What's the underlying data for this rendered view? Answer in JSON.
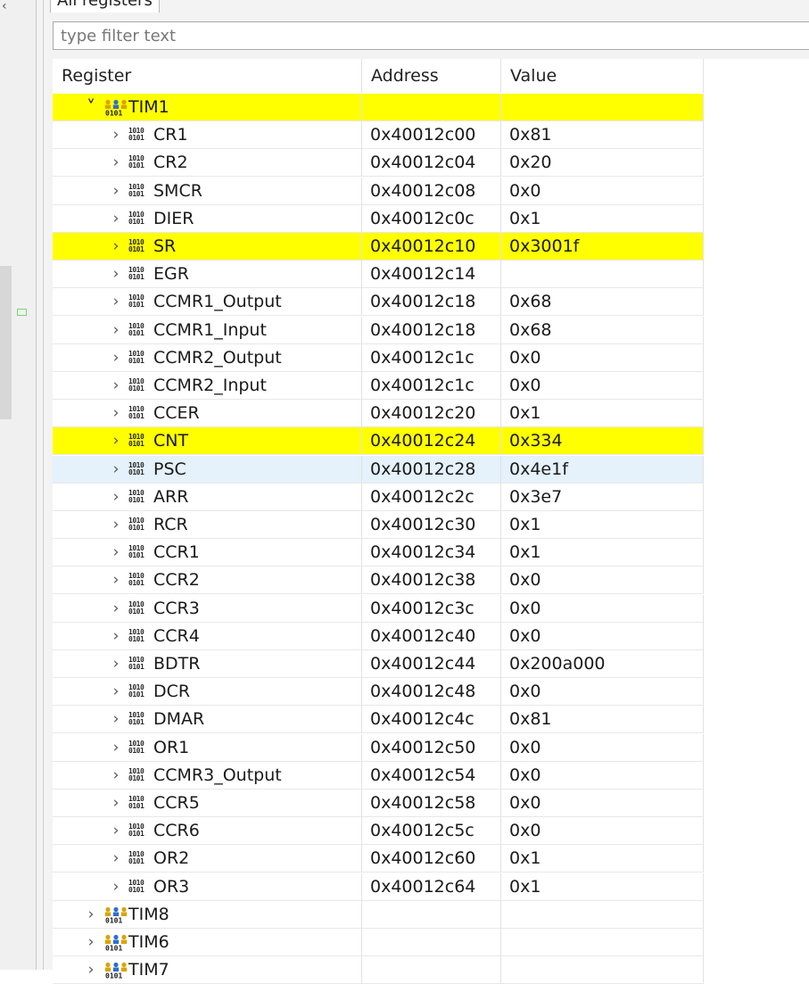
{
  "tab": {
    "label": "All registers"
  },
  "filter": {
    "placeholder": "type filter text",
    "value": ""
  },
  "columns": {
    "register": "Register",
    "address": "Address",
    "value": "Value"
  },
  "colors": {
    "highlight": "#ffff00",
    "selection": "#e5f1fb"
  },
  "rows": [
    {
      "kind": "group",
      "name": "TIM1",
      "expanded": true,
      "address": "",
      "value": "",
      "highlighted": true
    },
    {
      "kind": "register",
      "name": "CR1",
      "address": "0x40012c00",
      "value": "0x81"
    },
    {
      "kind": "register",
      "name": "CR2",
      "address": "0x40012c04",
      "value": "0x20"
    },
    {
      "kind": "register",
      "name": "SMCR",
      "address": "0x40012c08",
      "value": "0x0"
    },
    {
      "kind": "register",
      "name": "DIER",
      "address": "0x40012c0c",
      "value": "0x1"
    },
    {
      "kind": "register",
      "name": "SR",
      "address": "0x40012c10",
      "value": "0x3001f",
      "highlighted": true
    },
    {
      "kind": "register",
      "name": "EGR",
      "address": "0x40012c14",
      "value": ""
    },
    {
      "kind": "register",
      "name": "CCMR1_Output",
      "address": "0x40012c18",
      "value": "0x68"
    },
    {
      "kind": "register",
      "name": "CCMR1_Input",
      "address": "0x40012c18",
      "value": "0x68"
    },
    {
      "kind": "register",
      "name": "CCMR2_Output",
      "address": "0x40012c1c",
      "value": "0x0"
    },
    {
      "kind": "register",
      "name": "CCMR2_Input",
      "address": "0x40012c1c",
      "value": "0x0"
    },
    {
      "kind": "register",
      "name": "CCER",
      "address": "0x40012c20",
      "value": "0x1"
    },
    {
      "kind": "register",
      "name": "CNT",
      "address": "0x40012c24",
      "value": "0x334",
      "highlighted": true
    },
    {
      "kind": "register",
      "name": "PSC",
      "address": "0x40012c28",
      "value": "0x4e1f",
      "selected": true
    },
    {
      "kind": "register",
      "name": "ARR",
      "address": "0x40012c2c",
      "value": "0x3e7"
    },
    {
      "kind": "register",
      "name": "RCR",
      "address": "0x40012c30",
      "value": "0x1"
    },
    {
      "kind": "register",
      "name": "CCR1",
      "address": "0x40012c34",
      "value": "0x1"
    },
    {
      "kind": "register",
      "name": "CCR2",
      "address": "0x40012c38",
      "value": "0x0"
    },
    {
      "kind": "register",
      "name": "CCR3",
      "address": "0x40012c3c",
      "value": "0x0"
    },
    {
      "kind": "register",
      "name": "CCR4",
      "address": "0x40012c40",
      "value": "0x0"
    },
    {
      "kind": "register",
      "name": "BDTR",
      "address": "0x40012c44",
      "value": "0x200a000"
    },
    {
      "kind": "register",
      "name": "DCR",
      "address": "0x40012c48",
      "value": "0x0"
    },
    {
      "kind": "register",
      "name": "DMAR",
      "address": "0x40012c4c",
      "value": "0x81"
    },
    {
      "kind": "register",
      "name": "OR1",
      "address": "0x40012c50",
      "value": "0x0"
    },
    {
      "kind": "register",
      "name": "CCMR3_Output",
      "address": "0x40012c54",
      "value": "0x0"
    },
    {
      "kind": "register",
      "name": "CCR5",
      "address": "0x40012c58",
      "value": "0x0"
    },
    {
      "kind": "register",
      "name": "CCR6",
      "address": "0x40012c5c",
      "value": "0x0"
    },
    {
      "kind": "register",
      "name": "OR2",
      "address": "0x40012c60",
      "value": "0x1"
    },
    {
      "kind": "register",
      "name": "OR3",
      "address": "0x40012c64",
      "value": "0x1"
    },
    {
      "kind": "group",
      "name": "TIM8",
      "expanded": false,
      "address": "",
      "value": ""
    },
    {
      "kind": "group",
      "name": "TIM6",
      "expanded": false,
      "address": "",
      "value": ""
    },
    {
      "kind": "group",
      "name": "TIM7",
      "expanded": false,
      "address": "",
      "value": ""
    }
  ]
}
